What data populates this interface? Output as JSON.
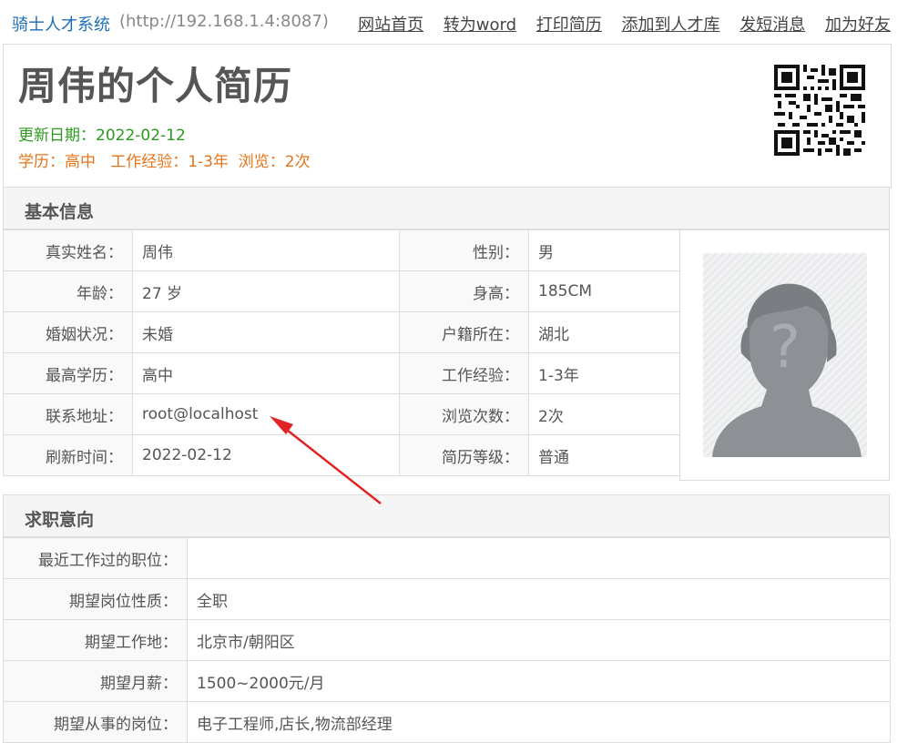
{
  "topbar": {
    "site_name": "骑士人才系统",
    "site_url": "(http://192.168.1.4:8087)",
    "nav": [
      "网站首页",
      "转为word",
      "打印简历",
      "添加到人才库",
      "发短消息",
      "加为好友"
    ]
  },
  "header": {
    "title": "周伟的个人简历",
    "update_label": "更新日期：",
    "update_date": "2022-02-12",
    "meta": "学历：高中   工作经验：1-3年  浏览：2次"
  },
  "basic": {
    "title": "基本信息",
    "rows": [
      {
        "l1": "真实姓名：",
        "v1": "周伟",
        "l2": "性别：",
        "v2": "男"
      },
      {
        "l1": "年龄：",
        "v1": "27 岁",
        "l2": "身高：",
        "v2": "185CM"
      },
      {
        "l1": "婚姻状况：",
        "v1": "未婚",
        "l2": "户籍所在：",
        "v2": "湖北"
      },
      {
        "l1": "最高学历：",
        "v1": "高中",
        "l2": "工作经验：",
        "v2": "1-3年"
      },
      {
        "l1": "联系地址：",
        "v1": "root@localhost",
        "l2": "浏览次数：",
        "v2": "2次"
      },
      {
        "l1": "刷新时间：",
        "v1": "2022-02-12",
        "l2": "简历等级：",
        "v2": "普通"
      }
    ]
  },
  "intention": {
    "title": "求职意向",
    "rows": [
      {
        "label": "最近工作过的职位：",
        "value": ""
      },
      {
        "label": "期望岗位性质：",
        "value": "全职"
      },
      {
        "label": "期望工作地：",
        "value": "北京市/朝阳区"
      },
      {
        "label": "期望月薪：",
        "value": "1500~2000元/月"
      },
      {
        "label": "期望从事的岗位：",
        "value": "电子工程师,店长,物流部经理"
      }
    ]
  },
  "colors": {
    "link": "#1d6fb8",
    "update": "#2b9a1f",
    "meta": "#e4751b",
    "arrow": "#e02424"
  }
}
